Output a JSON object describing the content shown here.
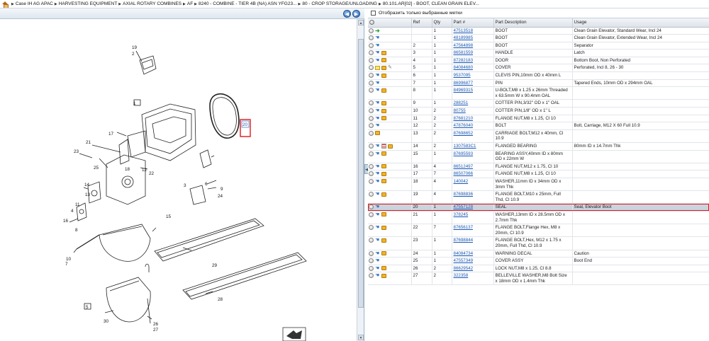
{
  "breadcrumb": [
    "Case IH AG APAC",
    "HARVESTING EQUIPMENT",
    "AXIAL ROTARY COMBINES",
    "AF",
    "8240 - COMBINE - TIER 4B (NA) ASN YFG23...",
    "80 - CROP STORAGE/UNLOADING",
    "80.101.AR[02] - BOOT, CLEAN GRAIN ELEV..."
  ],
  "nav": {
    "back": "◀",
    "forward": "▶"
  },
  "filter": {
    "label": "Отобразить только выбранные метки"
  },
  "columns": {
    "ref": "Ref",
    "qty": "Qty",
    "part": "Part #",
    "desc": "Part Description",
    "usage": "Usage"
  },
  "diagram_labels": [
    "19",
    "2",
    "1",
    "20",
    "17",
    "21",
    "23",
    "25",
    "18",
    "12",
    "22",
    "3",
    "6",
    "9",
    "24",
    "14",
    "13",
    "11",
    "4",
    "15",
    "8",
    "16",
    "10",
    "7",
    "29",
    "28",
    "5",
    "30",
    "26",
    "27"
  ],
  "rows": [
    {
      "icons": [
        "arrow"
      ],
      "ref": "",
      "qty": "1",
      "part": "47513518",
      "desc": "BOOT",
      "usage": "Clean Grain Elevator, Standard Wear, Incl 24"
    },
    {
      "icons": [
        "hand"
      ],
      "ref": "",
      "qty": "1",
      "part": "48189985",
      "desc": "BOOT",
      "usage": "Clean Grain Elevator, Extended Wear, Incl 24"
    },
    {
      "icons": [
        "hand"
      ],
      "ref": "2",
      "qty": "1",
      "part": "47564898",
      "desc": "BOOT",
      "usage": "Separator"
    },
    {
      "icons": [
        "hand",
        "cart"
      ],
      "ref": "3",
      "qty": "1",
      "part": "86581559",
      "desc": "HANDLE",
      "usage": "Latch"
    },
    {
      "icons": [
        "hand",
        "cart"
      ],
      "ref": "4",
      "qty": "1",
      "part": "87282183",
      "desc": "DOOR",
      "usage": "Bottom Boot, Non Perforated"
    },
    {
      "icons": [
        "note",
        "cart",
        "tool"
      ],
      "ref": "5",
      "qty": "1",
      "part": "84084680",
      "desc": "COVER",
      "usage": "Perforated, Incl 8, 26 - 30"
    },
    {
      "icons": [
        "hand",
        "cart"
      ],
      "ref": "6",
      "qty": "1",
      "part": "9537095",
      "desc": "CLEVIS PIN,10mm OD x 40mm L",
      "usage": ""
    },
    {
      "icons": [
        "hand"
      ],
      "ref": "7",
      "qty": "1",
      "part": "86996877",
      "desc": "PIN",
      "usage": "Tapered Ends, 10mm OD x 294mm OAL"
    },
    {
      "icons": [
        "hand",
        "cart"
      ],
      "ref": "8",
      "qty": "1",
      "part": "84969315",
      "desc": "U-BOLT,M8 x 1.25 x 26mm Threaded x 63.5mm W x 90.4mm OAL",
      "usage": ""
    },
    {
      "icons": [
        "hand",
        "cart"
      ],
      "ref": "9",
      "qty": "1",
      "part": "288251",
      "desc": "COTTER PIN,3/32\" OD x 1\" OAL",
      "usage": ""
    },
    {
      "icons": [
        "hand",
        "cart"
      ],
      "ref": "10",
      "qty": "2",
      "part": "80755",
      "desc": "COTTER PIN,1/8\" OD x 1\" L",
      "usage": ""
    },
    {
      "icons": [
        "hand",
        "cart"
      ],
      "ref": "11",
      "qty": "2",
      "part": "87681210",
      "desc": "FLANGE NUT,M8 x 1.25, Cl 10",
      "usage": ""
    },
    {
      "icons": [
        "hand"
      ],
      "ref": "12",
      "qty": "2",
      "part": "47876040",
      "desc": "BOLT",
      "usage": "Bolt, Carriage, M12 X 60 Full 10.9"
    },
    {
      "icons": [
        "cart"
      ],
      "ref": "13",
      "qty": "2",
      "part": "87698652",
      "desc": "CARRIAGE BOLT,M12 x 40mm, Cl 10.9",
      "usage": ""
    },
    {
      "icons": [
        "hand",
        "list",
        "cart"
      ],
      "ref": "14",
      "qty": "2",
      "part": "1307583C1",
      "desc": "FLANGED BEARING",
      "usage": "80mm ID x 14.7mm Thk"
    },
    {
      "icons": [
        "hand",
        "cart"
      ],
      "ref": "15",
      "qty": "1",
      "part": "87695593",
      "desc": "BEARING ASSY,40mm ID x 80mm OD x 22mm W",
      "usage": ""
    },
    {
      "icons": [
        "hand",
        "cart"
      ],
      "ref": "16",
      "qty": "4",
      "part": "86512497",
      "desc": "FLANGE NUT,M12 x 1.75, Cl 10",
      "usage": ""
    },
    {
      "icons": [
        "hand",
        "cart"
      ],
      "ref": "17",
      "qty": "7",
      "part": "86507066",
      "desc": "FLANGE NUT,M8 x 1.25, Cl 10",
      "usage": ""
    },
    {
      "icons": [
        "hand",
        "cart"
      ],
      "ref": "18",
      "qty": "4",
      "part": "140042",
      "desc": "WASHER,11mm ID x 34mm OD x 3mm Thk",
      "usage": ""
    },
    {
      "icons": [
        "hand",
        "cart"
      ],
      "ref": "19",
      "qty": "4",
      "part": "87698836",
      "desc": "FLANGE BOLT,M10 x 25mm, Full Thd, Cl 10.9",
      "usage": ""
    },
    {
      "icons": [
        "hand"
      ],
      "ref": "20",
      "qty": "1",
      "part": "47557128",
      "desc": "SEAL",
      "usage": "Seal, Elevator Boot",
      "sel": true
    },
    {
      "icons": [
        "hand",
        "cart"
      ],
      "ref": "21",
      "qty": "1",
      "part": "378245",
      "desc": "WASHER,13mm ID x 28.5mm OD x 2.7mm Thk",
      "usage": ""
    },
    {
      "icons": [
        "hand",
        "cart"
      ],
      "ref": "22",
      "qty": "7",
      "part": "87656137",
      "desc": "FLANGE BOLT,Flange Hex, M8 x 20mm, Cl 10.9",
      "usage": ""
    },
    {
      "icons": [
        "hand",
        "cart"
      ],
      "ref": "23",
      "qty": "1",
      "part": "87698844",
      "desc": "FLANGE BOLT,Hex, M12 x 1.75 x 20mm, Full Thd, Cl 10.9",
      "usage": ""
    },
    {
      "icons": [
        "hand",
        "cart"
      ],
      "ref": "24",
      "qty": "1",
      "part": "84084734",
      "desc": "WARNING DECAL",
      "usage": "Caution"
    },
    {
      "icons": [
        "hand"
      ],
      "ref": "25",
      "qty": "1",
      "part": "47557349",
      "desc": "COVER ASSY",
      "usage": "Boot End"
    },
    {
      "icons": [
        "hand",
        "cart"
      ],
      "ref": "26",
      "qty": "2",
      "part": "86629542",
      "desc": "LOCK NUT,M8 x 1.25, Cl 8.8",
      "usage": ""
    },
    {
      "icons": [
        "hand",
        "cart"
      ],
      "ref": "27",
      "qty": "2",
      "part": "322358",
      "desc": "BELLEVILLE WASHER,M8 Bolt Size x 18mm OD x 1.4mm Thk",
      "usage": ""
    }
  ]
}
